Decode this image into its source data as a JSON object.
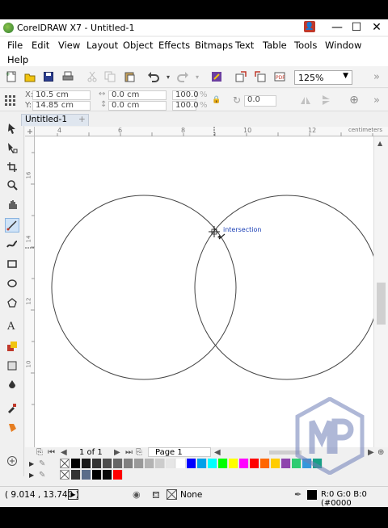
{
  "window": {
    "title": "CorelDRAW X7 - Untitled-1",
    "controls": {
      "minimize": "—",
      "restore": "☐",
      "close": "✕"
    }
  },
  "menu": [
    {
      "label": "File",
      "key": "F"
    },
    {
      "label": "Edit",
      "key": "E"
    },
    {
      "label": "View",
      "key": "V"
    },
    {
      "label": "Layout",
      "key": "L"
    },
    {
      "label": "Object",
      "key": "j"
    },
    {
      "label": "Effects",
      "key": "c"
    },
    {
      "label": "Bitmaps",
      "key": "B"
    },
    {
      "label": "Text",
      "key": "x"
    },
    {
      "label": "Table",
      "key": "T"
    },
    {
      "label": "Tools",
      "key": "o"
    },
    {
      "label": "Window",
      "key": "W"
    },
    {
      "label": "Help",
      "key": "H"
    }
  ],
  "toolbar": {
    "zoom_level": "125%",
    "more": "»"
  },
  "property_bar": {
    "x_label": "X:",
    "x_value": "10.5 cm",
    "y_label": "Y:",
    "y_value": "14.85 cm",
    "w_value": "0.0 cm",
    "h_value": "0.0 cm",
    "scale_x": "100.0",
    "scale_y": "100.0",
    "pct": "%",
    "rotation": "0.0",
    "more": "»"
  },
  "document_tab": {
    "label": "Untitled-1",
    "add_icon": "+"
  },
  "rulers": {
    "unit": "centimeters",
    "h_ticks": [
      "4",
      "6",
      "8",
      "10",
      "12"
    ],
    "v_ticks": [
      "16",
      "14",
      "12",
      "10"
    ]
  },
  "canvas": {
    "snap_label": "intersection"
  },
  "page_nav": {
    "page_count": "1 of 1",
    "page_tab": "Page 1"
  },
  "palette": {
    "colors": [
      "#000000",
      "#1a1a1a",
      "#333333",
      "#4d4d4d",
      "#666666",
      "#808080",
      "#999999",
      "#b3b3b3",
      "#cccccc",
      "#e6e6e6",
      "#ffffff",
      "#0000ff",
      "#00a0e9",
      "#00ffff",
      "#00ff00",
      "#ffff00",
      "#ff00ff",
      "#ff0000",
      "#ff6600",
      "#ffcc00",
      "#8e44ad",
      "#2ecc71",
      "#3498db",
      "#16a085"
    ],
    "doc_colors": [
      "#333333",
      "#5b6d8a",
      "#000000",
      "#0a0a0a",
      "#ff0000"
    ]
  },
  "status_bar": {
    "cursor_position": "( 9.014 , 13.740 )",
    "fill_label": "None",
    "outline_value": "R:0 G:0 B:0 (#0000"
  }
}
